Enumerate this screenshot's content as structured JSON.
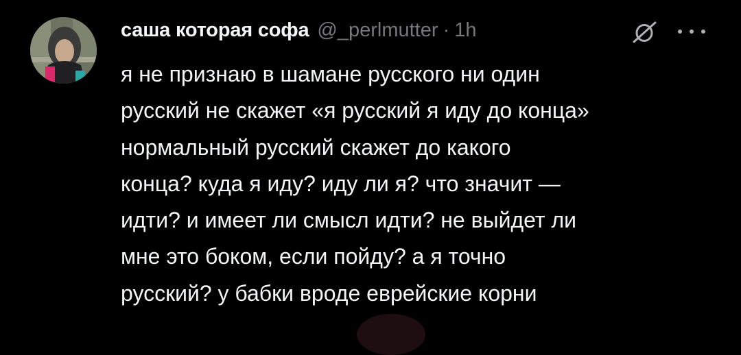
{
  "post": {
    "author": "саша которая софа",
    "handle": "@_perlmutter",
    "separator": "·",
    "time": "1h",
    "body_lines": [
      "я не признаю в шамане русского ни один",
      "русский не скажет «я русский я иду до конца»",
      "нормальный русский скажет до какого",
      "конца? куда я иду? иду ли я? что значит —",
      "идти? и имеет ли смысл идти? не выйдет ли",
      "мне это боком, если пойду? а я точно",
      "русский? у бабки вроде еврейские корни"
    ]
  },
  "icons": {
    "avatar": "profile-photo",
    "nostr": "slashed-circle-icon",
    "more": "more-dots-icon"
  },
  "colors": {
    "background": "#000000",
    "text_primary": "#f3f5f7",
    "text_secondary": "#77777b"
  }
}
